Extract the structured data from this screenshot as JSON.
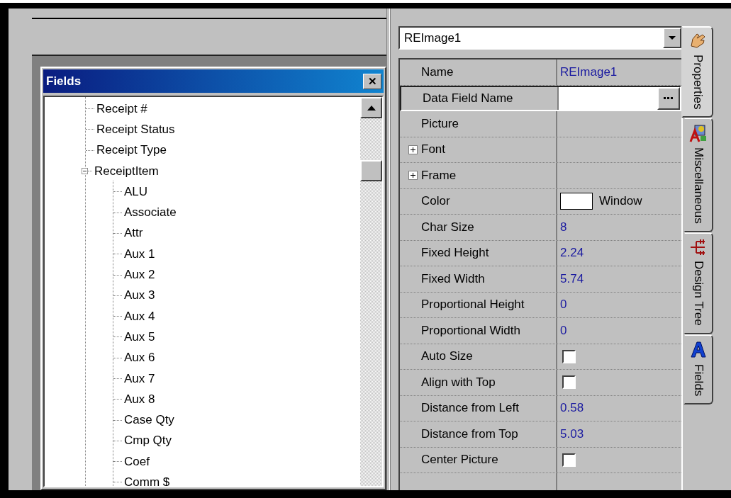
{
  "fields_window": {
    "title": "Fields",
    "close": "✕",
    "tree": [
      {
        "label": "Receipt #"
      },
      {
        "label": "Receipt Status"
      },
      {
        "label": "Receipt Type"
      },
      {
        "label": "ReceiptItem",
        "expanded": true,
        "children": [
          {
            "label": "ALU"
          },
          {
            "label": "Associate"
          },
          {
            "label": "Attr"
          },
          {
            "label": "Aux 1"
          },
          {
            "label": "Aux 2"
          },
          {
            "label": "Aux 3"
          },
          {
            "label": "Aux 4"
          },
          {
            "label": "Aux 5"
          },
          {
            "label": "Aux 6"
          },
          {
            "label": "Aux 7"
          },
          {
            "label": "Aux 8"
          },
          {
            "label": "Case Qty"
          },
          {
            "label": "Cmp Qty"
          },
          {
            "label": "Coef"
          },
          {
            "label": "Comm $"
          }
        ]
      }
    ]
  },
  "properties": {
    "object_selector": "REImage1",
    "rows": [
      {
        "kind": "text",
        "name": "Name",
        "value": "REImage1",
        "selected": false
      },
      {
        "kind": "editor",
        "name": "Data Field Name",
        "selected": true
      },
      {
        "kind": "empty",
        "name": "Picture",
        "selected": false
      },
      {
        "kind": "group",
        "name": "Font",
        "expanded": false,
        "selected": false
      },
      {
        "kind": "group",
        "name": "Frame",
        "expanded": false,
        "selected": false
      },
      {
        "kind": "color",
        "name": "Color",
        "value": "Window",
        "color": "#ffffff",
        "selected": false
      },
      {
        "kind": "text",
        "name": "Char Size",
        "value": "8",
        "selected": false
      },
      {
        "kind": "text",
        "name": "Fixed Height",
        "value": "2.24",
        "selected": false
      },
      {
        "kind": "text",
        "name": "Fixed Width",
        "value": "5.74",
        "selected": false
      },
      {
        "kind": "text",
        "name": "Proportional Height",
        "value": "0",
        "selected": false
      },
      {
        "kind": "text",
        "name": "Proportional Width",
        "value": "0",
        "selected": false
      },
      {
        "kind": "checkbox",
        "name": "Auto Size",
        "checked": false,
        "selected": false
      },
      {
        "kind": "checkbox",
        "name": "Align with Top",
        "checked": false,
        "selected": false
      },
      {
        "kind": "text",
        "name": "Distance from Left",
        "value": "0.58",
        "selected": false
      },
      {
        "kind": "text",
        "name": "Distance from Top",
        "value": "5.03",
        "selected": false
      },
      {
        "kind": "checkbox",
        "name": "Center Picture",
        "checked": false,
        "selected": false
      }
    ]
  },
  "side_tabs": [
    {
      "kind": "hand",
      "label": "Properties",
      "selected": true
    },
    {
      "kind": "misc",
      "label": "Miscellaneous",
      "selected": false
    },
    {
      "kind": "tree",
      "label": "Design Tree",
      "selected": false
    },
    {
      "kind": "letter",
      "label": "Fields",
      "selected": false
    }
  ]
}
